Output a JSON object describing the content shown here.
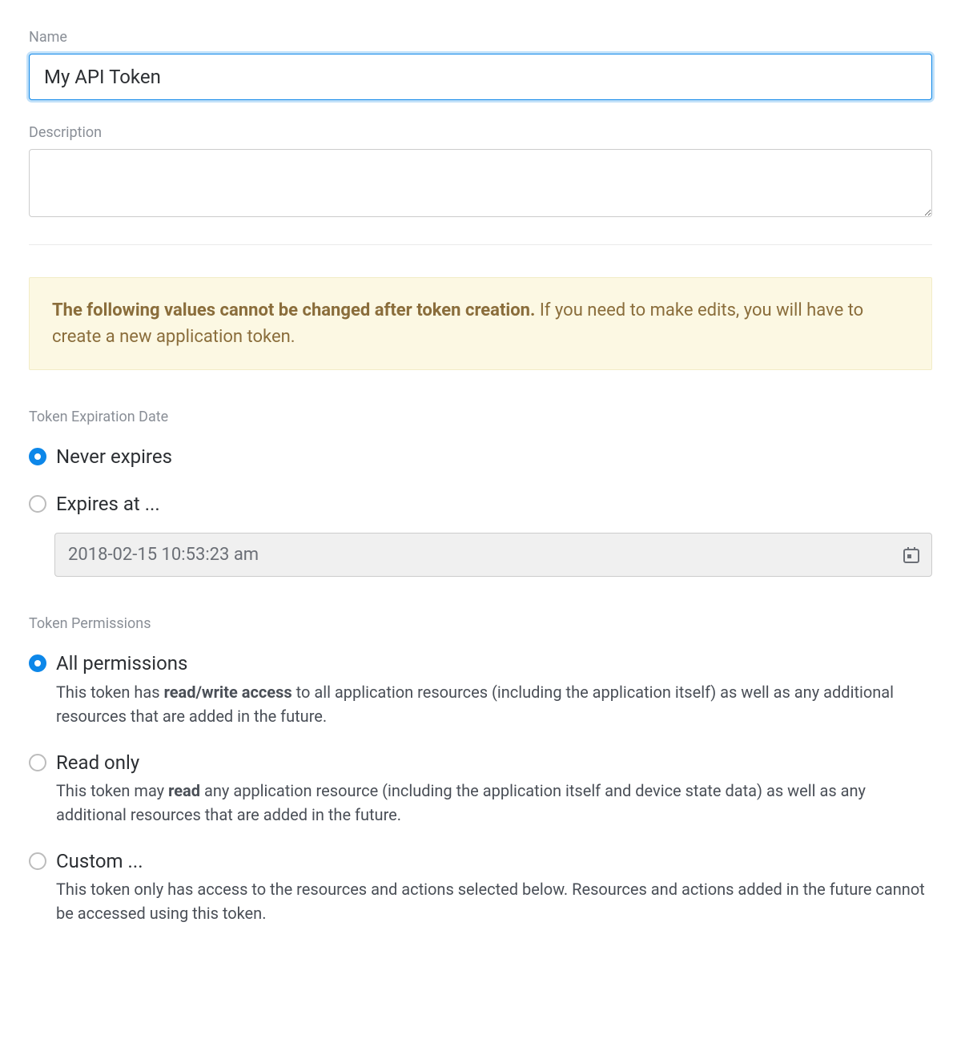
{
  "name": {
    "label": "Name",
    "value": "My API Token"
  },
  "description": {
    "label": "Description",
    "value": ""
  },
  "callout": {
    "bold": "The following values cannot be changed after token creation.",
    "rest": "If you need to make edits, you will have to create a new application token."
  },
  "expiration": {
    "label": "Token Expiration Date",
    "options": {
      "never": {
        "label": "Never expires",
        "selected": true
      },
      "expires_at": {
        "label": "Expires at ...",
        "selected": false
      }
    },
    "date_value": "2018-02-15 10:53:23 am"
  },
  "permissions": {
    "label": "Token Permissions",
    "options": {
      "all": {
        "label": "All permissions",
        "selected": true,
        "desc_pre": "This token has ",
        "desc_bold": "read/write access",
        "desc_post": " to all application resources (including the application itself) as well as any additional resources that are added in the future."
      },
      "read": {
        "label": "Read only",
        "selected": false,
        "desc_pre": "This token may ",
        "desc_bold": "read",
        "desc_post": " any application resource (including the application itself and device state data) as well as any additional resources that are added in the future."
      },
      "custom": {
        "label": "Custom ...",
        "selected": false,
        "desc": "This token only has access to the resources and actions selected below. Resources and actions added in the future cannot be accessed using this token."
      }
    }
  }
}
